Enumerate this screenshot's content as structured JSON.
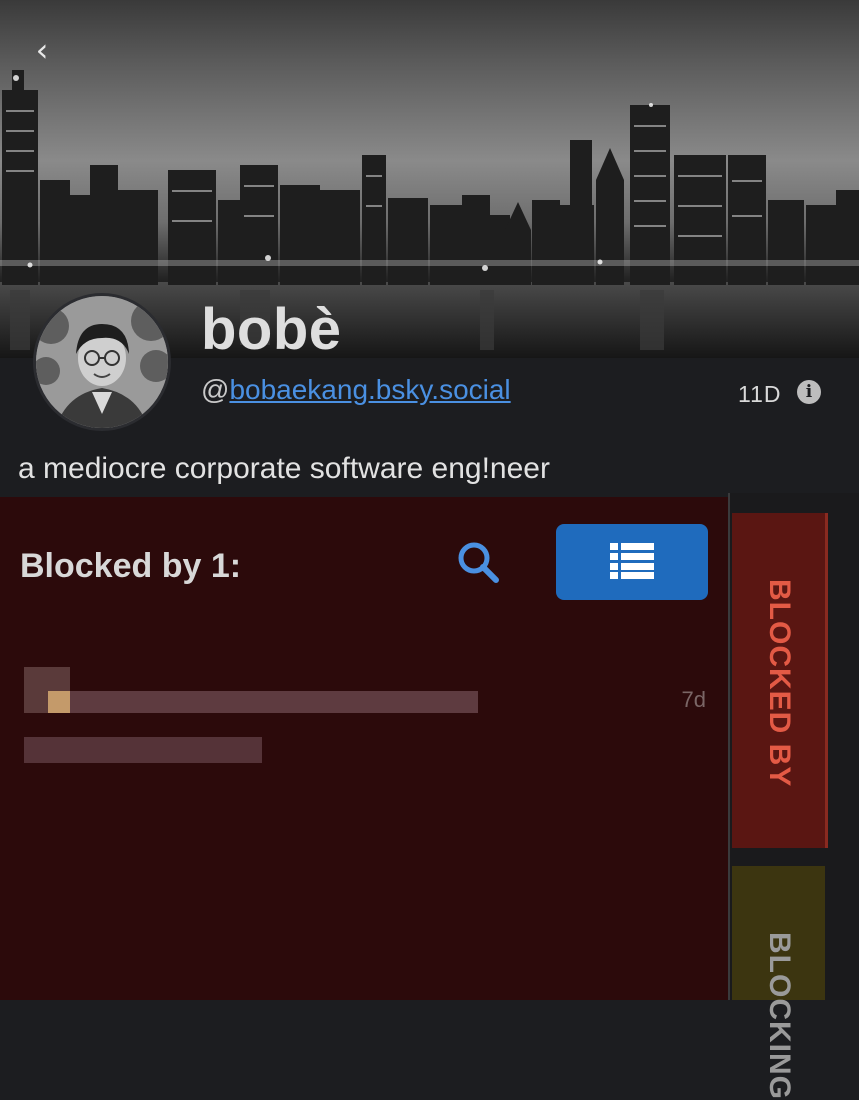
{
  "profile": {
    "display_name": "bobè",
    "handle_prefix": "@",
    "handle": "bobaekang.bsky.social",
    "account_age": "11D",
    "bio": "a mediocre corporate software eng!neer"
  },
  "icons": {
    "back": "chevron-left-icon",
    "info": "info-icon",
    "search": "search-icon",
    "list": "list-icon"
  },
  "list_panel": {
    "title": "Blocked by 1:",
    "items": [
      {
        "time": "7d"
      }
    ]
  },
  "tabs": [
    {
      "label": "BLOCKED BY",
      "active": true
    },
    {
      "label": "BLOCKING",
      "active": false
    }
  ],
  "colors": {
    "accent_blue": "#1f6bbd",
    "link_blue": "#4a90e2",
    "panel_bg": "#2c0a0b",
    "tab_blocked_by": "#5a1612",
    "tab_blocked_by_text": "#e35a45"
  }
}
